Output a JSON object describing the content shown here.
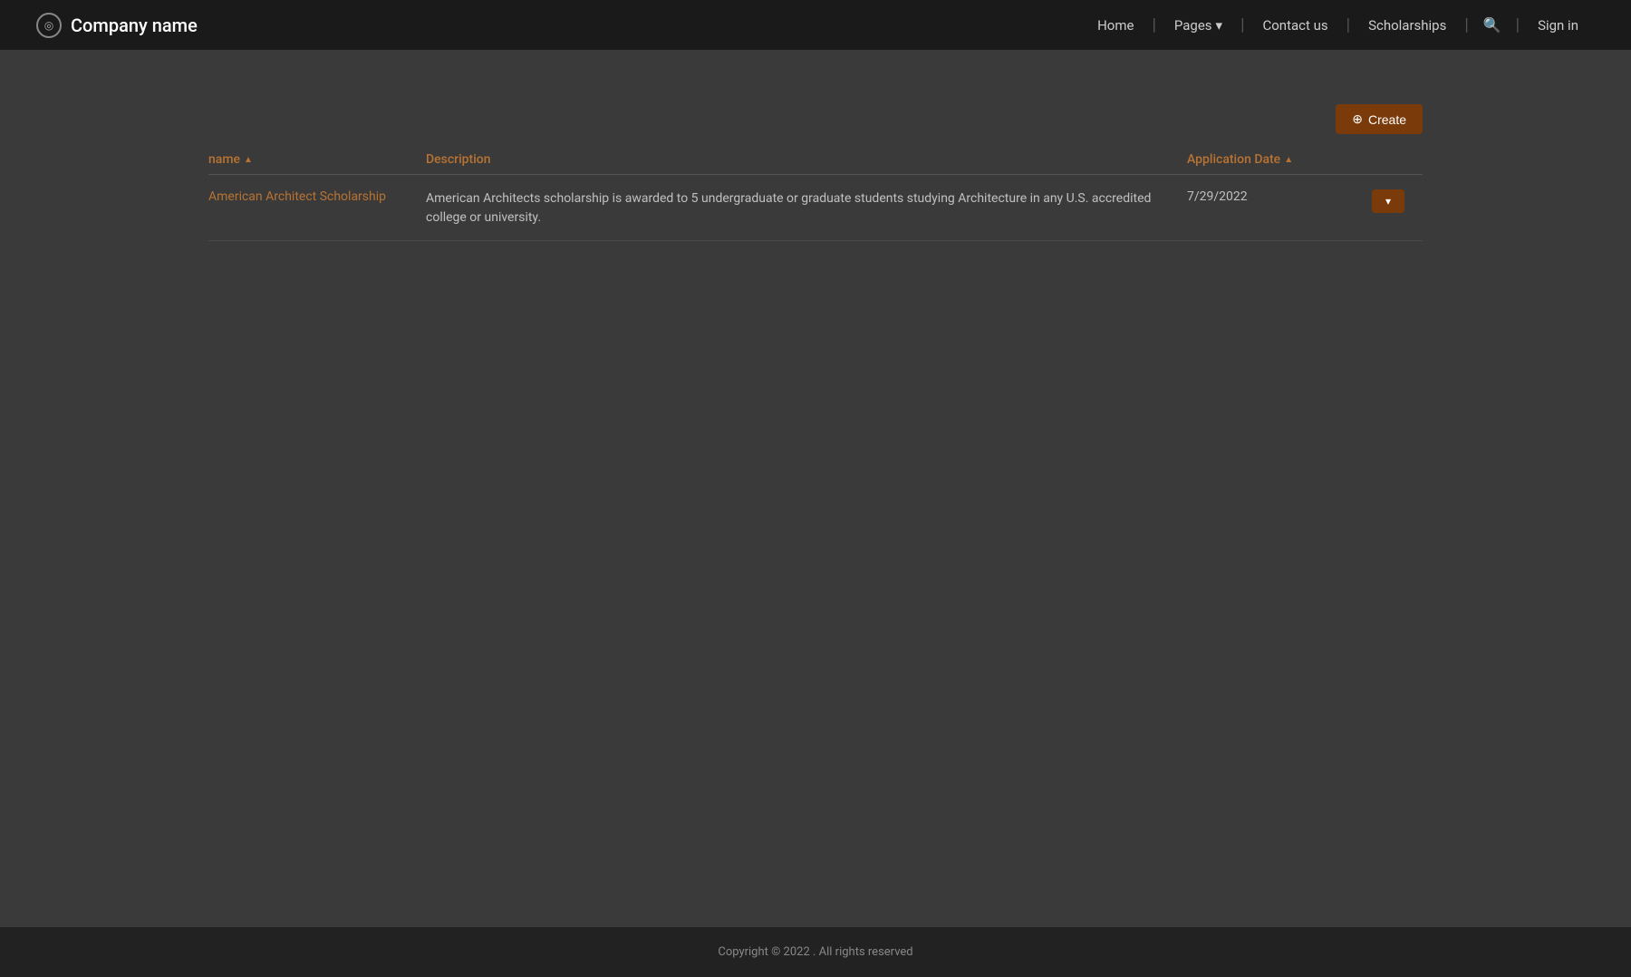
{
  "navbar": {
    "brand": {
      "name": "Company name",
      "icon": "◎"
    },
    "nav_items": [
      {
        "label": "Home",
        "has_dropdown": false
      },
      {
        "label": "Pages",
        "has_dropdown": true
      },
      {
        "label": "Contact us",
        "has_dropdown": false
      },
      {
        "label": "Scholarships",
        "has_dropdown": false
      }
    ],
    "signin_label": "Sign in"
  },
  "toolbar": {
    "create_button_label": "Create",
    "create_icon": "⊕"
  },
  "table": {
    "columns": [
      {
        "label": "name",
        "sortable": true
      },
      {
        "label": "Description",
        "sortable": false
      },
      {
        "label": "Application Date",
        "sortable": true
      }
    ],
    "rows": [
      {
        "name": "American Architect Scholarship",
        "description": "American Architects scholarship is awarded to 5 undergraduate or graduate students studying Architecture in any U.S. accredited college or university.",
        "application_date": "7/29/2022"
      }
    ]
  },
  "footer": {
    "copyright": "Copyright © 2022 . All rights reserved"
  },
  "colors": {
    "navbar_bg": "#1a1a1a",
    "body_bg": "#3a3a3a",
    "accent": "#7a3a0a",
    "accent_text": "#b87333",
    "footer_bg": "#222222"
  }
}
